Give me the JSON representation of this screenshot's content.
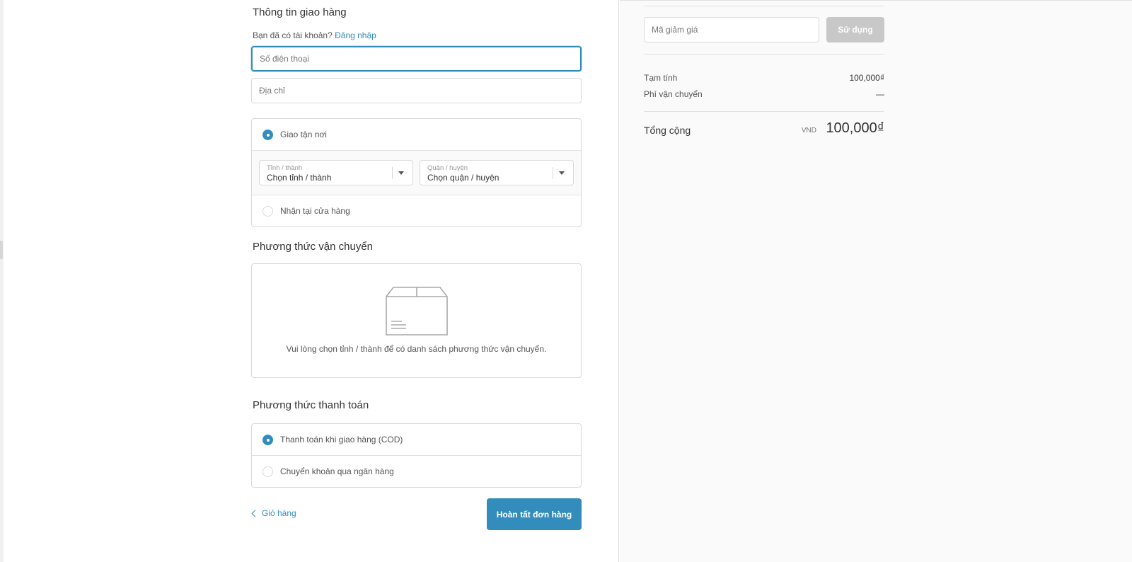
{
  "shipping_info": {
    "title": "Thông tin giao hàng",
    "have_account_text": "Bạn đã có tài khoản?",
    "login_link": "Đăng nhập",
    "phone_placeholder": "Số điện thoại",
    "address_placeholder": "Địa chỉ",
    "delivery_option": "Giao tận nơi",
    "province": {
      "label": "Tỉnh / thành",
      "value": "Chọn tỉnh / thành"
    },
    "district": {
      "label": "Quận / huyện",
      "value": "Chọn quận / huyện"
    },
    "pickup_option": "Nhận tại cửa hàng"
  },
  "shipping_method": {
    "title": "Phương thức vận chuyển",
    "empty_message": "Vui lòng chọn tỉnh / thành để có danh sách phương thức vận chuyển.",
    "icon": "package-box-icon"
  },
  "payment_method": {
    "title": "Phương thức thanh toán",
    "options": [
      "Thanh toán khi giao hàng (COD)",
      "Chuyển khoản qua ngân hàng"
    ]
  },
  "footer": {
    "back_label": "Giỏ hàng",
    "complete_label": "Hoàn tất đơn hàng"
  },
  "summary": {
    "discount_placeholder": "Mã giảm giá",
    "apply_label": "Sử dụng",
    "subtotal_label": "Tạm tính",
    "subtotal_value": "100,000₫",
    "shipping_fee_label": "Phí vận chuyển",
    "shipping_fee_value": "—",
    "total_label": "Tổng cộng",
    "currency": "VND",
    "total_value": "100,000₫"
  },
  "colors": {
    "accent": "#338dbc",
    "disabled_button": "#c8c8c8",
    "sidebar_bg": "#fafafa"
  }
}
